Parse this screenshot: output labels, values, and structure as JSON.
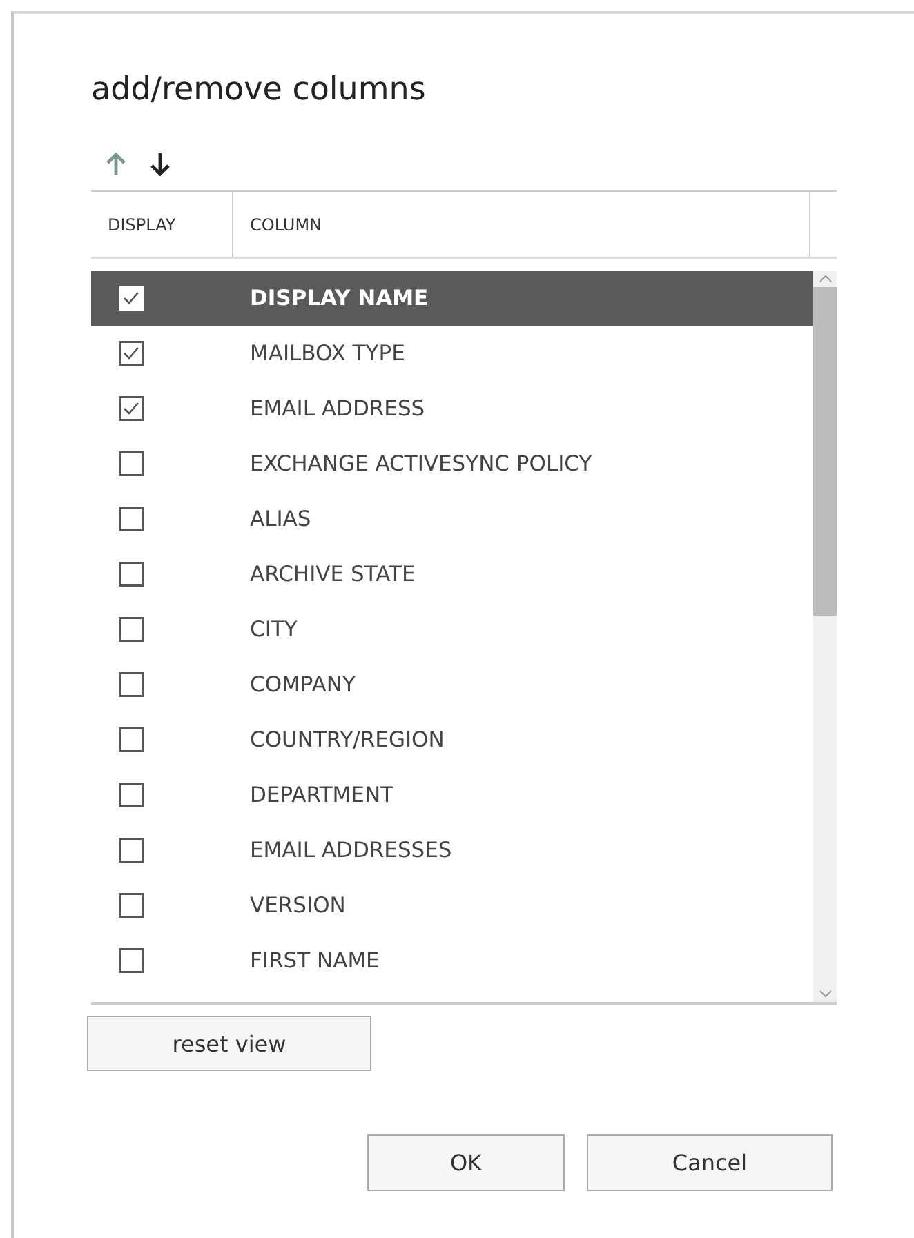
{
  "dialog": {
    "title": "add/remove columns"
  },
  "toolbar": [
    {
      "kind": "up",
      "disabled": true
    },
    {
      "kind": "down",
      "disabled": false
    }
  ],
  "table": {
    "columns": [
      "DISPLAY",
      "COLUMN"
    ],
    "rows": [
      {
        "name": "DISPLAY NAME",
        "checked": true,
        "selected": true
      },
      {
        "name": "MAILBOX TYPE",
        "checked": true,
        "selected": false
      },
      {
        "name": "EMAIL ADDRESS",
        "checked": true,
        "selected": false
      },
      {
        "name": "EXCHANGE ACTIVESYNC POLICY",
        "checked": false,
        "selected": false
      },
      {
        "name": "ALIAS",
        "checked": false,
        "selected": false
      },
      {
        "name": "ARCHIVE STATE",
        "checked": false,
        "selected": false
      },
      {
        "name": "CITY",
        "checked": false,
        "selected": false
      },
      {
        "name": "COMPANY",
        "checked": false,
        "selected": false
      },
      {
        "name": "COUNTRY/REGION",
        "checked": false,
        "selected": false
      },
      {
        "name": "DEPARTMENT",
        "checked": false,
        "selected": false
      },
      {
        "name": "EMAIL ADDRESSES",
        "checked": false,
        "selected": false
      },
      {
        "name": "VERSION",
        "checked": false,
        "selected": false
      },
      {
        "name": "FIRST NAME",
        "checked": false,
        "selected": false
      }
    ]
  },
  "reset_button": "reset view",
  "buttons": [
    "OK",
    "Cancel"
  ]
}
